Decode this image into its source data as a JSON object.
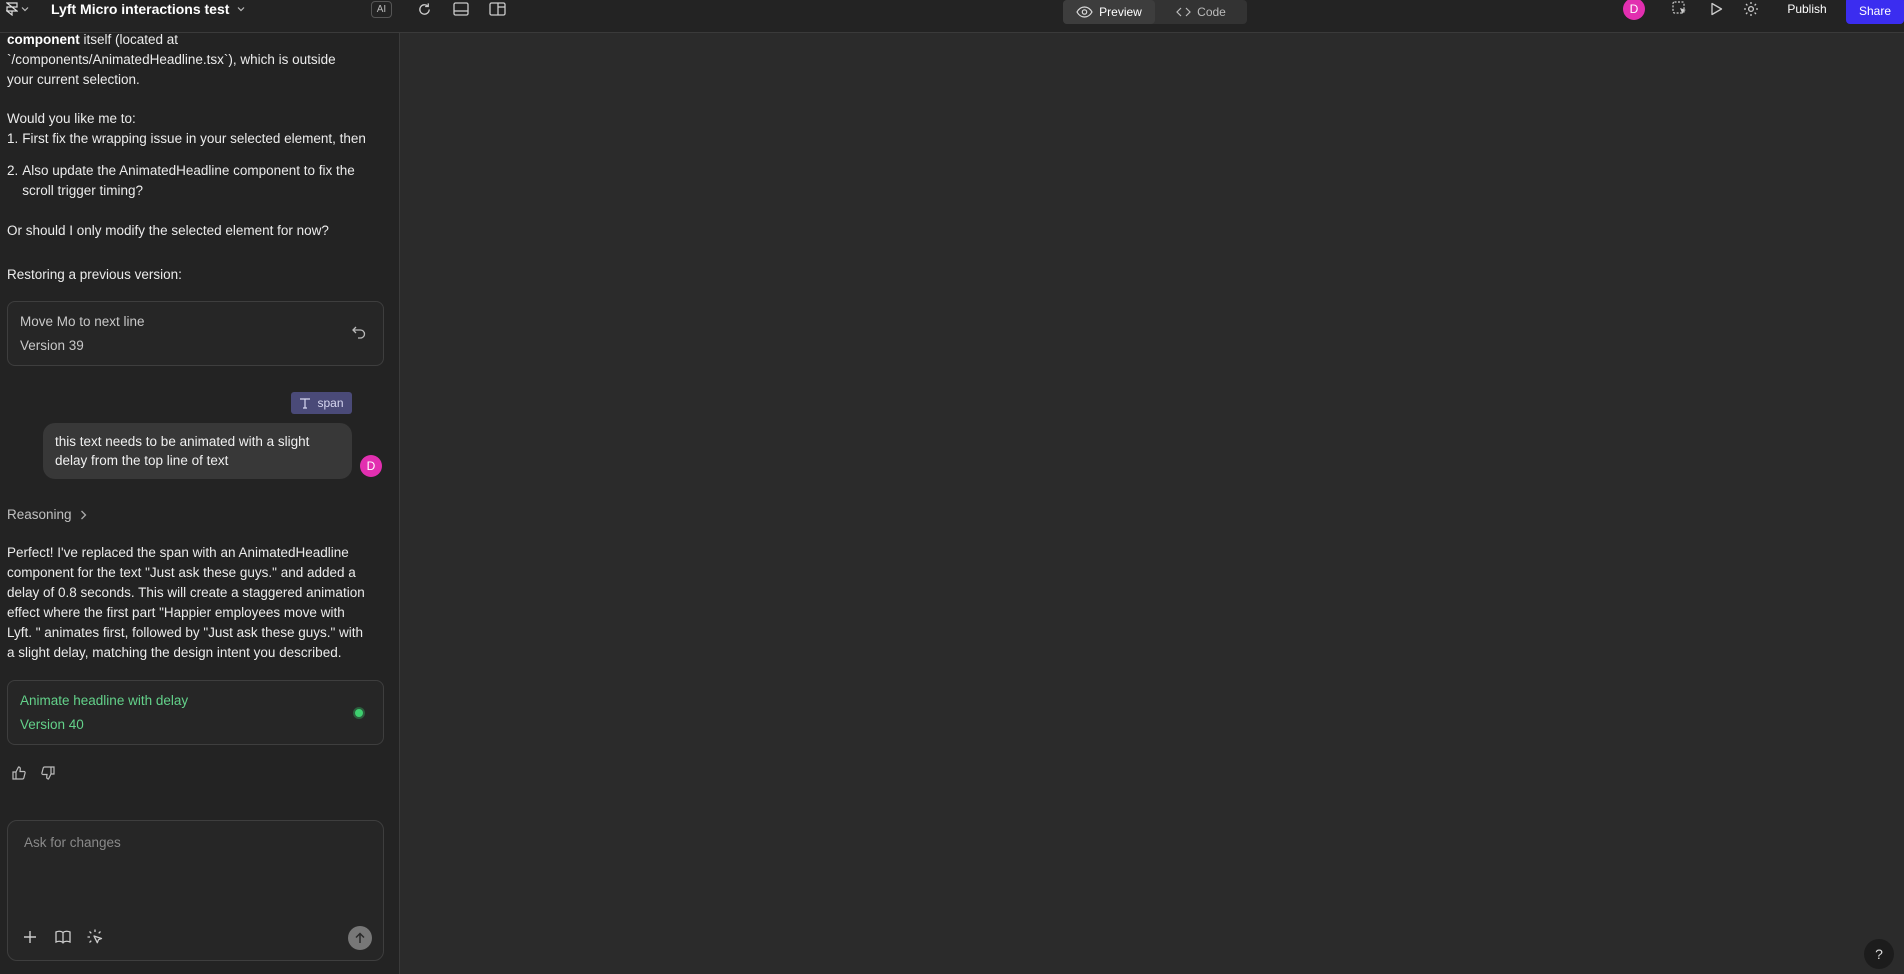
{
  "header": {
    "project_title": "Lyft Micro interactions test",
    "ai_badge": "AI",
    "preview_label": "Preview",
    "code_label": "Code",
    "avatar_initial": "D",
    "publish_label": "Publish",
    "share_label": "Share"
  },
  "chat": {
    "intro_bold": "component",
    "intro_rest_1": " itself (located at",
    "intro_line_2": "`/components/AnimatedHeadline.tsx`), which is outside",
    "intro_line_3": "your current selection.",
    "question": "Would you like me to:",
    "option_1_num": "1.",
    "option_1": "First fix the wrapping issue in your selected element, then",
    "option_2_num": "2.",
    "option_2_line_1": "Also update the AnimatedHeadline component to fix the",
    "option_2_line_2": "scroll trigger timing?",
    "or_question": "Or should I only modify the selected element for now?",
    "restoring": "Restoring a previous version:",
    "card_1_title": "Move Mo to next line",
    "card_1_version": "Version 39",
    "chip_label": "span",
    "user_message": "this text needs to be animated with a slight delay from the top line of text",
    "user_initial": "D",
    "reasoning_label": "Reasoning",
    "response_lines": [
      "Perfect! I've replaced the span with an AnimatedHeadline",
      "component for the text \"Just ask these guys.\" and added a",
      "delay of 0.8 seconds. This will create a staggered animation",
      "effect where the first part \"Happier employees move with",
      "Lyft. \" animates first, followed by \"Just ask these guys.\" with",
      "a slight delay, matching the design intent you described."
    ],
    "card_2_title": "Animate headline with delay",
    "card_2_version": "Version 40"
  },
  "composer": {
    "placeholder": "Ask for changes"
  },
  "help_label": "?",
  "colors": {
    "accent": "#3b2df0",
    "avatar": "#e22fb0",
    "success": "#63d18a"
  }
}
